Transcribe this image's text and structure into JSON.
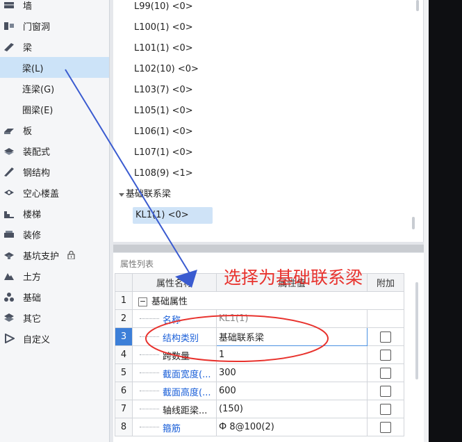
{
  "nav": {
    "items": [
      {
        "label": "墙",
        "icon": "wall-icon",
        "sub": false
      },
      {
        "label": "门窗洞",
        "icon": "door-window-icon",
        "sub": false
      },
      {
        "label": "梁",
        "icon": "beam-icon",
        "sub": false
      },
      {
        "label": "梁(L)",
        "icon": "",
        "sub": true,
        "selected": true
      },
      {
        "label": "连梁(G)",
        "icon": "",
        "sub": true
      },
      {
        "label": "圈梁(E)",
        "icon": "",
        "sub": true
      },
      {
        "label": "板",
        "icon": "slab-icon",
        "sub": false
      },
      {
        "label": "装配式",
        "icon": "prefab-icon",
        "sub": false
      },
      {
        "label": "钢结构",
        "icon": "steel-structure-icon",
        "sub": false
      },
      {
        "label": "空心楼盖",
        "icon": "hollow-floor-icon",
        "sub": false
      },
      {
        "label": "楼梯",
        "icon": "stair-icon",
        "sub": false
      },
      {
        "label": "装修",
        "icon": "decoration-icon",
        "sub": false
      },
      {
        "label": "基坑支护",
        "icon": "pit-support-icon",
        "sub": false,
        "locked": true
      },
      {
        "label": "土方",
        "icon": "earthwork-icon",
        "sub": false
      },
      {
        "label": "基础",
        "icon": "foundation-icon",
        "sub": false
      },
      {
        "label": "其它",
        "icon": "other-icon",
        "sub": false
      },
      {
        "label": "自定义",
        "icon": "custom-icon",
        "sub": false
      }
    ]
  },
  "list": {
    "items": [
      "L99(10) <0>",
      "L100(1) <0>",
      "L101(1) <0>",
      "L102(10) <0>",
      "L103(7) <0>",
      "L105(1) <0>",
      "L106(1) <0>",
      "L107(1) <0>",
      "L108(9) <1>"
    ],
    "group_label": "基础联系梁",
    "selected_item": "KL1(1) <0>"
  },
  "properties": {
    "title": "属性列表",
    "columns": {
      "name": "属性名称",
      "value": "属性值",
      "extra": "附加"
    },
    "group_header": "基础属性",
    "rows": [
      {
        "num": "2",
        "name": "名称",
        "value": "KL1(1)",
        "blue": true,
        "check": false
      },
      {
        "num": "3",
        "name": "结构类别",
        "value": "基础联系梁",
        "blue": true,
        "check": true,
        "active": true
      },
      {
        "num": "4",
        "name": "跨数量",
        "value": "1",
        "blue": false,
        "check": true
      },
      {
        "num": "5",
        "name": "截面宽度(...",
        "value": "300",
        "blue": true,
        "check": true
      },
      {
        "num": "6",
        "name": "截面高度(...",
        "value": "600",
        "blue": true,
        "check": true
      },
      {
        "num": "7",
        "name": "轴线距梁...",
        "value": "(150)",
        "blue": false,
        "check": true
      },
      {
        "num": "8",
        "name": "箍筋",
        "value": "Ф 8@100(2)",
        "blue": true,
        "check": true
      }
    ]
  },
  "annotation": {
    "text": "选择为基础联系梁",
    "color": "#e8322d"
  },
  "colors": {
    "selected_bg": "#cce3f8",
    "accent_blue": "#1a5fd8",
    "annotation_red": "#e8322d",
    "arrow_blue": "#3a5bd0"
  }
}
